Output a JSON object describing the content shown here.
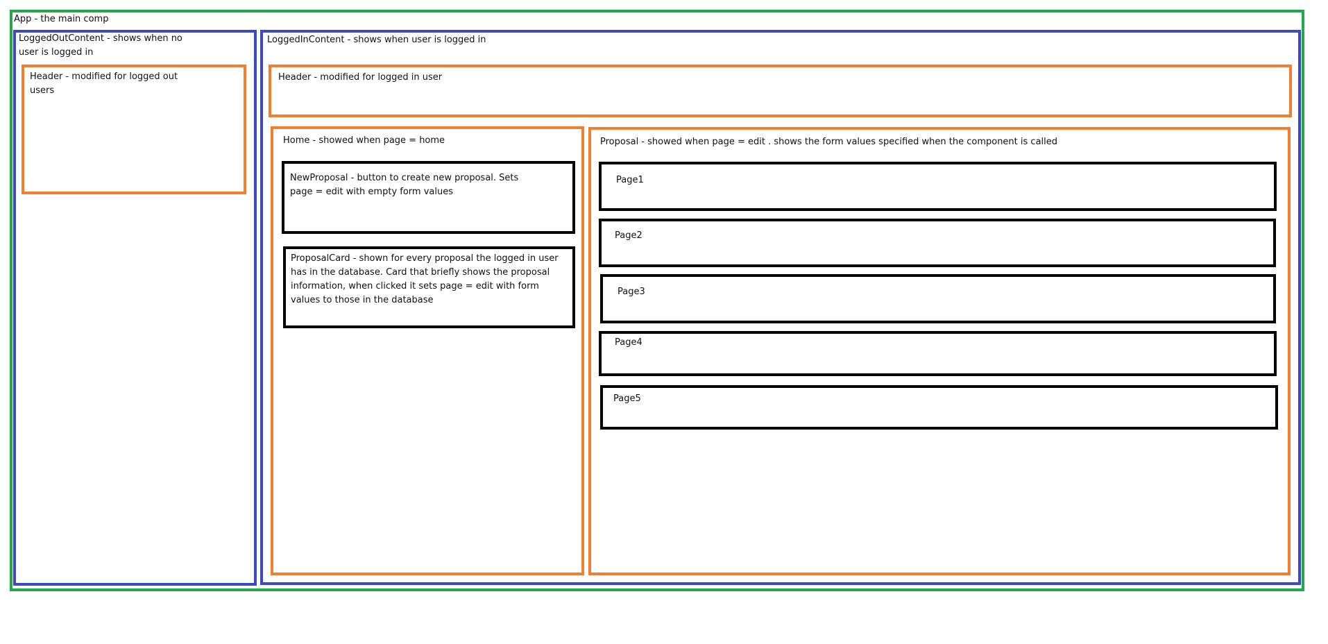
{
  "app": {
    "label": "App - the main comp"
  },
  "logged_out_content": {
    "label": "LoggedOutContent - shows when no user is logged in",
    "header": {
      "label": "Header - modified for logged out users"
    }
  },
  "logged_in_content": {
    "label": "LoggedInContent - shows when user is logged in",
    "header": {
      "label": "Header - modified for logged in user"
    },
    "home": {
      "label": "Home - showed when page = home",
      "new_proposal": {
        "label": "NewProposal - button to create new proposal. Sets page = edit with empty form values"
      },
      "proposal_card": {
        "label": "ProposalCard - shown for every proposal the logged in user has in the database. Card that briefly shows the proposal information, when clicked it sets page = edit with form values to those in the database"
      }
    },
    "proposal": {
      "label": "Proposal - showed when page = edit . shows the form values specified when the component is called",
      "pages": [
        {
          "label": "Page1"
        },
        {
          "label": "Page2"
        },
        {
          "label": "Page3"
        },
        {
          "label": "Page4"
        },
        {
          "label": "Page5"
        }
      ]
    }
  },
  "colors": {
    "app": "#22aa4a",
    "content": "#3d48c6",
    "component": "#f47e2f",
    "subcomponent": "#000000"
  }
}
